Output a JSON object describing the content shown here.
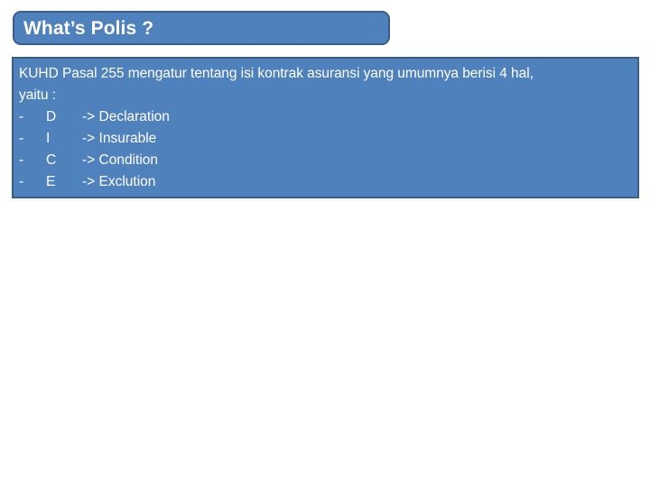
{
  "slide": {
    "background_color": "#FFFFFF",
    "accent_fill": "#4F81BD",
    "accent_border": "#385D8A",
    "text_color": "#FFFFFF"
  },
  "title": {
    "text": "What’s Polis ?"
  },
  "body": {
    "paragraph_line_1": "KUHD Pasal 255 mengatur tentang isi kontrak asuransi yang umumnya berisi 4 hal,",
    "paragraph_line_2": "yaitu :",
    "items": [
      {
        "bullet": "-",
        "letter": "D",
        "definition": "-> Declaration"
      },
      {
        "bullet": "-",
        "letter": "I",
        "definition": "-> Insurable"
      },
      {
        "bullet": "-",
        "letter": "C",
        "definition": "-> Condition"
      },
      {
        "bullet": "-",
        "letter": "E",
        "definition": "-> Exclution"
      }
    ]
  }
}
